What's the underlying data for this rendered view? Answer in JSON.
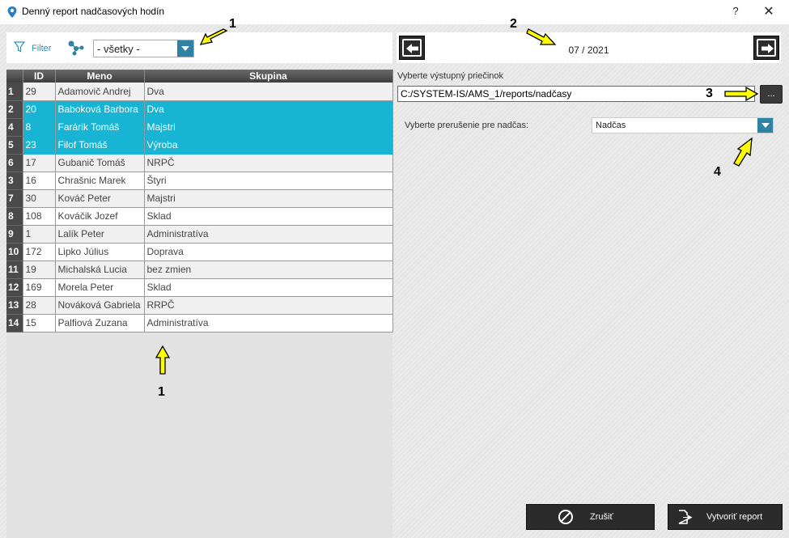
{
  "window": {
    "title": "Denný report nadčasových hodín",
    "help_label": "?",
    "close_label": "✕"
  },
  "filter": {
    "label": "Filter",
    "group_combo_value": "- všetky -"
  },
  "grid": {
    "headers": [
      "ID",
      "Meno",
      "Skupina"
    ],
    "rows": [
      {
        "n": "1",
        "id": "29",
        "name": "Adamovič Andrej",
        "group": "Dva",
        "selected": false
      },
      {
        "n": "2",
        "id": "20",
        "name": "Baboková Barbora",
        "group": "Dva",
        "selected": true
      },
      {
        "n": "4",
        "id": "8",
        "name": "Farárik Tomáš",
        "group": "Majstri",
        "selected": true
      },
      {
        "n": "5",
        "id": "23",
        "name": "Filof Tomáš",
        "group": "Výroba",
        "selected": true
      },
      {
        "n": "6",
        "id": "17",
        "name": "Gubanič Tomáš",
        "group": "NRPČ",
        "selected": false
      },
      {
        "n": "3",
        "id": "16",
        "name": "Chrašnic Marek",
        "group": "Štyri",
        "selected": false
      },
      {
        "n": "7",
        "id": "30",
        "name": "Kováč Peter",
        "group": "Majstri",
        "selected": false
      },
      {
        "n": "8",
        "id": "108",
        "name": "Kováčik Jozef",
        "group": "Sklad",
        "selected": false
      },
      {
        "n": "9",
        "id": "1",
        "name": "Lalík Peter",
        "group": "Administratíva",
        "selected": false
      },
      {
        "n": "10",
        "id": "172",
        "name": "Lipko Július",
        "group": "Doprava",
        "selected": false
      },
      {
        "n": "11",
        "id": "19",
        "name": "Michalská Lucia",
        "group": "bez zmien",
        "selected": false
      },
      {
        "n": "12",
        "id": "169",
        "name": "Morela Peter",
        "group": "Sklad",
        "selected": false
      },
      {
        "n": "13",
        "id": "28",
        "name": "Nováková Gabriela",
        "group": "RRPČ",
        "selected": false
      },
      {
        "n": "14",
        "id": "15",
        "name": "Palfiová Zuzana",
        "group": "Administratíva",
        "selected": false
      }
    ]
  },
  "month_nav": {
    "month_label": "07 / 2021"
  },
  "output": {
    "folder_label": "Vyberte výstupný priečinok",
    "folder_value": "C:/SYSTEM-IS/AMS_1/reports/nadčasy",
    "browse_label": "..."
  },
  "break": {
    "label": "Vyberte prerušenie pre nadčas:",
    "value": "Nadčas"
  },
  "actions": {
    "cancel_label": "Zrušiť",
    "create_label": "Vytvoriť report"
  },
  "annotations": {
    "a1_top": "1",
    "a2": "2",
    "a3": "3",
    "a4": "4",
    "a1_bottom": "1",
    "arrow_color": "#ffff00"
  },
  "colors": {
    "accent": "#2e82a6",
    "selected_row": "#17b4d4",
    "filter_text": "#2a8fb8"
  }
}
